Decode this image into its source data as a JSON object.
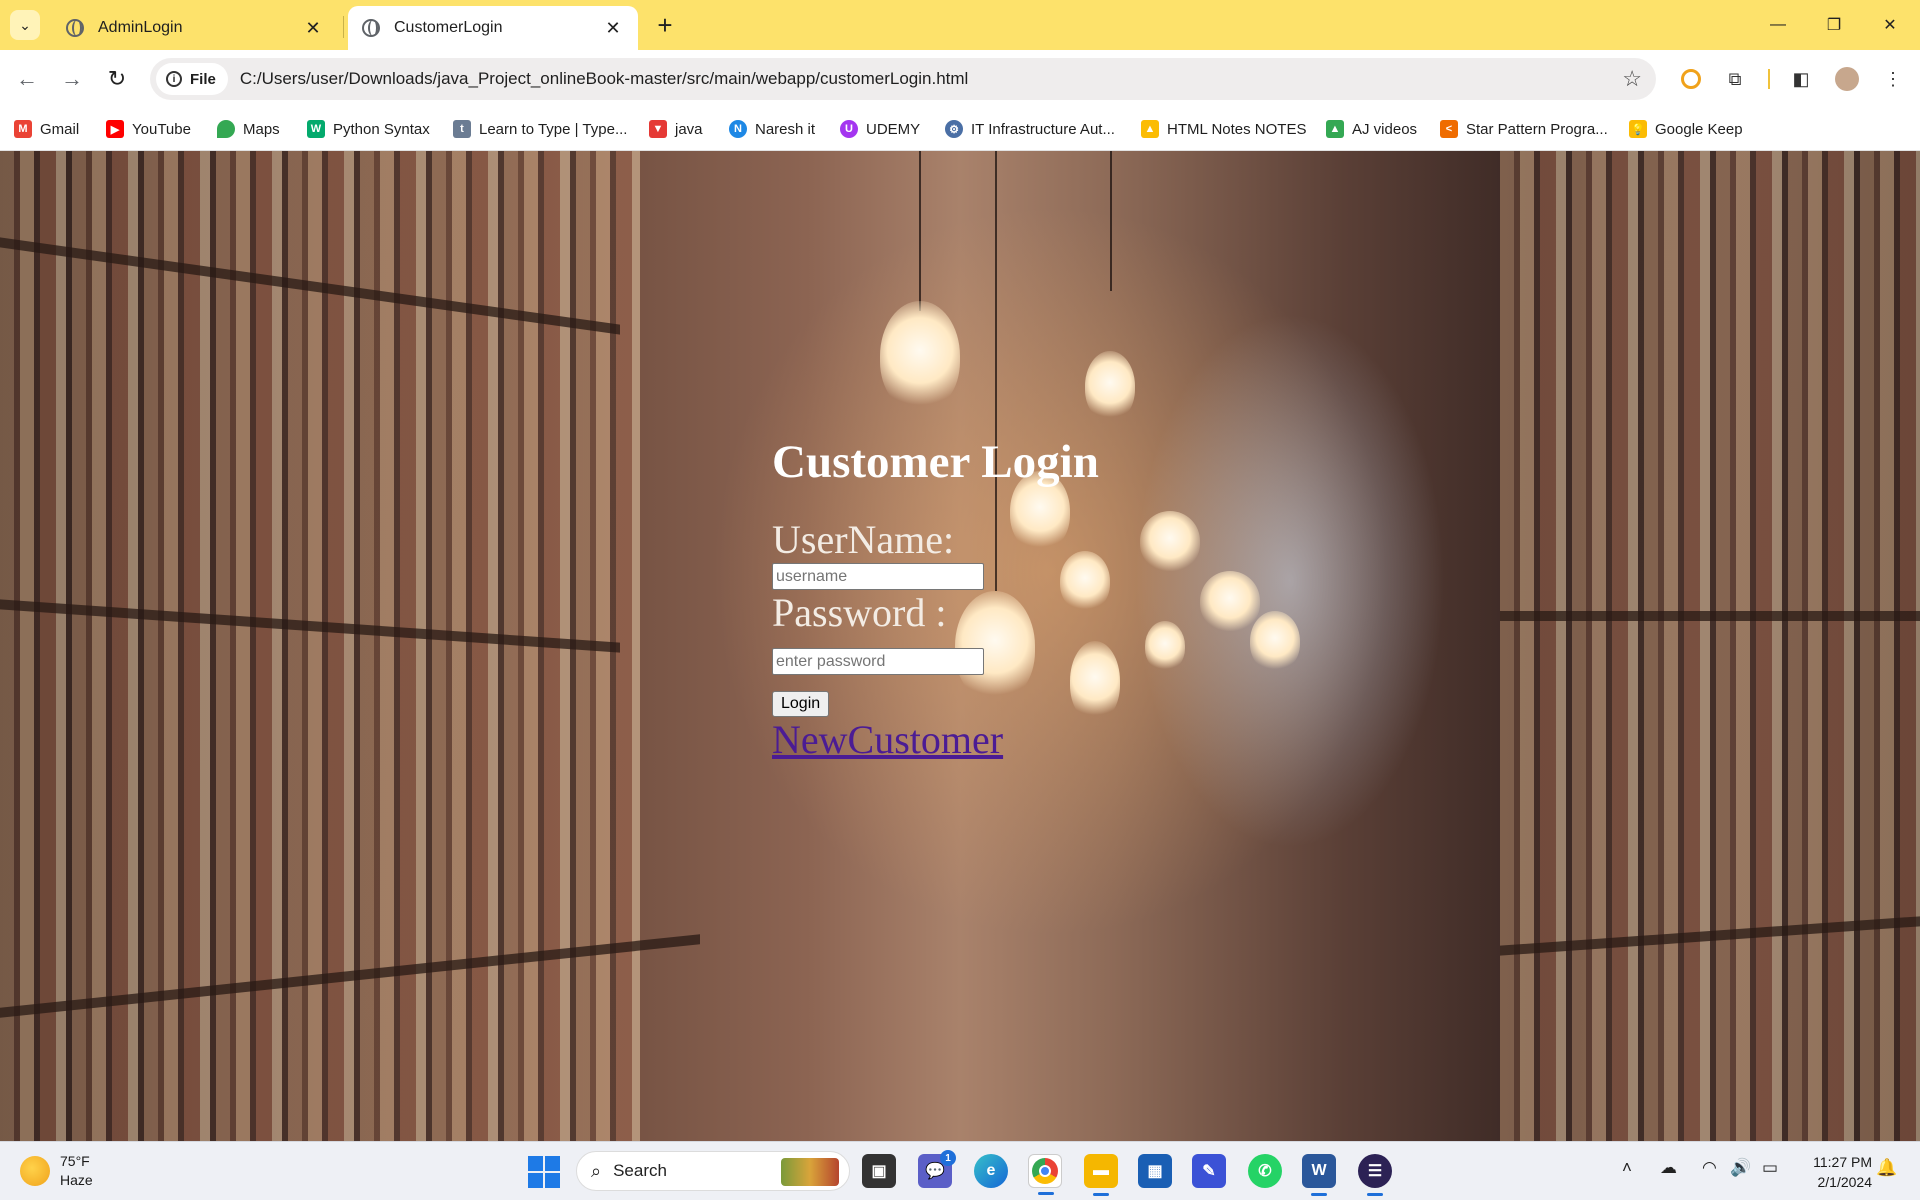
{
  "browser": {
    "tabs": [
      {
        "title": "AdminLogin",
        "active": false
      },
      {
        "title": "CustomerLogin",
        "active": true
      }
    ],
    "address": {
      "chip_label": "File",
      "url": "C:/Users/user/Downloads/java_Project_onlineBook-master/src/main/webapp/customerLogin.html"
    },
    "bookmarks": [
      {
        "label": "Gmail",
        "icon": "gmail-icon",
        "color": "#ea4335"
      },
      {
        "label": "YouTube",
        "icon": "youtube-icon",
        "color": "#ff0000"
      },
      {
        "label": "Maps",
        "icon": "maps-icon",
        "color": "#34a853"
      },
      {
        "label": "Python Syntax",
        "icon": "w3schools-icon",
        "color": "#04aa6d"
      },
      {
        "label": "Learn to Type | Type...",
        "icon": "typing-icon",
        "color": "#6b7c93"
      },
      {
        "label": "java",
        "icon": "java-icon",
        "color": "#e53935"
      },
      {
        "label": "Naresh it",
        "icon": "nareshit-icon",
        "color": "#1e88e5"
      },
      {
        "label": "UDEMY",
        "icon": "udemy-icon",
        "color": "#a435f0"
      },
      {
        "label": "IT Infrastructure Aut...",
        "icon": "it-infra-icon",
        "color": "#4a6fa5"
      },
      {
        "label": "HTML Notes NOTES",
        "icon": "drive-icon",
        "color": "#fbbc04"
      },
      {
        "label": "AJ videos",
        "icon": "drive-icon",
        "color": "#34a853"
      },
      {
        "label": "Star Pattern Progra...",
        "icon": "star-pattern-icon",
        "color": "#ef6c00"
      },
      {
        "label": "Google Keep",
        "icon": "keep-icon",
        "color": "#fbbc04"
      }
    ]
  },
  "login": {
    "heading": "Customer Login",
    "username_label": "UserName:",
    "username_placeholder": "username",
    "password_label": "Password :",
    "password_placeholder": "enter password",
    "button": "Login",
    "link": "NewCustomer"
  },
  "taskbar": {
    "weather_temp": "75°F",
    "weather_desc": "Haze",
    "search": "Search",
    "teams_badge": "1",
    "time": "11:27 PM",
    "date": "2/1/2024"
  }
}
